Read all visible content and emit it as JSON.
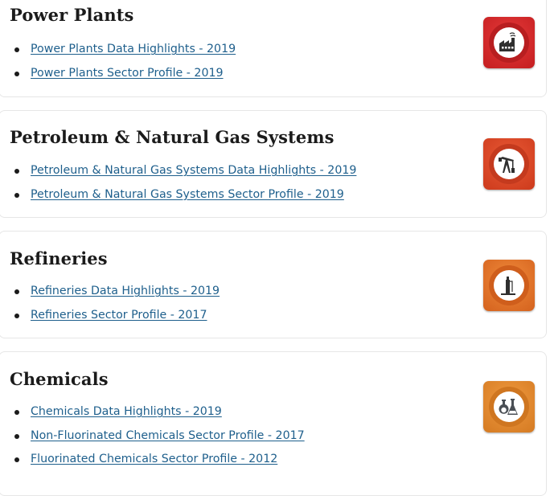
{
  "sections": [
    {
      "title": "Power Plants",
      "icon": "power-plant-factory-icon",
      "colors": {
        "bg": "#d8282a",
        "ring": "#b81e20"
      },
      "links": [
        "Power Plants Data Highlights - 2019",
        "Power Plants Sector Profile - 2019"
      ]
    },
    {
      "title": "Petroleum & Natural Gas Systems",
      "icon": "oil-pump-jack-icon",
      "colors": {
        "bg": "#e0482a",
        "ring": "#c43a1e"
      },
      "links": [
        "Petroleum & Natural Gas Systems Data Highlights - 2019",
        "Petroleum & Natural Gas Systems Sector Profile - 2019"
      ]
    },
    {
      "title": "Refineries",
      "icon": "refinery-tower-icon",
      "colors": {
        "bg": "#e8722a",
        "ring": "#cf5e1c"
      },
      "links": [
        "Refineries Data Highlights - 2019",
        "Refineries Sector Profile - 2017"
      ]
    },
    {
      "title": "Chemicals",
      "icon": "chemical-flasks-icon",
      "colors": {
        "bg": "#e8892e",
        "ring": "#cf7620"
      },
      "links": [
        "Chemicals Data Highlights - 2019",
        "Non-Fluorinated Chemicals Sector Profile - 2017",
        "Fluorinated Chemicals Sector Profile - 2012"
      ]
    }
  ],
  "colors": {
    "link": "#1e5f8c",
    "heading": "#1b1b1b",
    "border": "#e6e6e6"
  }
}
